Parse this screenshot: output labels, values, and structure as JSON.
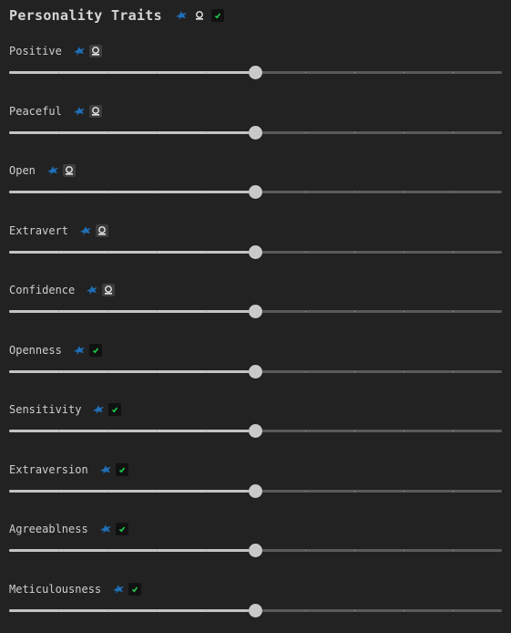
{
  "panel": {
    "title": "Personality Traits",
    "icons": [
      "bird-icon",
      "seal-icon",
      "check-icon"
    ]
  },
  "colors": {
    "background": "#222222",
    "track": "#5a5a5a",
    "fill": "#c4c4c4",
    "thumb": "#c9c9c9",
    "bird": "#1f6fb8",
    "check": "#1ecf4a"
  },
  "traits": [
    {
      "label": "Positive",
      "value": 0.5,
      "icons": [
        "bird-icon",
        "seal-icon"
      ]
    },
    {
      "label": "Peaceful",
      "value": 0.5,
      "icons": [
        "bird-icon",
        "seal-icon"
      ]
    },
    {
      "label": "Open",
      "value": 0.5,
      "icons": [
        "bird-icon",
        "seal-icon"
      ]
    },
    {
      "label": "Extravert",
      "value": 0.5,
      "icons": [
        "bird-icon",
        "seal-icon"
      ]
    },
    {
      "label": "Confidence",
      "value": 0.5,
      "icons": [
        "bird-icon",
        "seal-icon"
      ]
    },
    {
      "label": "Openness",
      "value": 0.5,
      "icons": [
        "bird-icon",
        "check-icon"
      ]
    },
    {
      "label": "Sensitivity",
      "value": 0.5,
      "icons": [
        "bird-icon",
        "check-icon"
      ]
    },
    {
      "label": "Extraversion",
      "value": 0.5,
      "icons": [
        "bird-icon",
        "check-icon"
      ]
    },
    {
      "label": "Agreeablness",
      "value": 0.5,
      "icons": [
        "bird-icon",
        "check-icon"
      ]
    },
    {
      "label": "Meticulousness",
      "value": 0.5,
      "icons": [
        "bird-icon",
        "check-icon"
      ]
    }
  ]
}
